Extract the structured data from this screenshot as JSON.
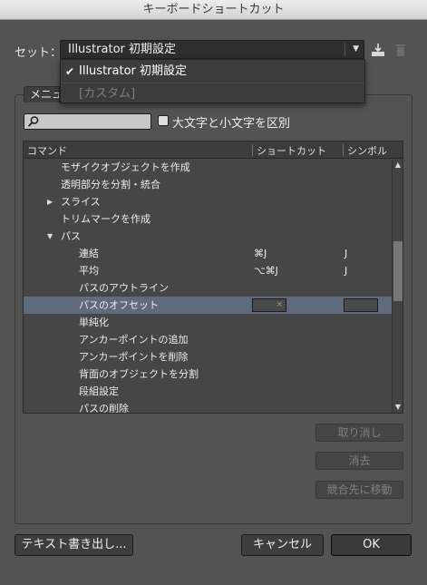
{
  "window": {
    "title": "キーボードショートカット"
  },
  "set": {
    "label": "セット：",
    "selected": "Illustrator 初期設定",
    "options": [
      {
        "label": "Illustrator 初期設定",
        "checked": true
      },
      {
        "label": "[カスタム]",
        "disabled": true
      }
    ]
  },
  "tab": {
    "label": "メニューコマンド"
  },
  "search": {
    "value": "",
    "case_label": "大文字と小文字を区別"
  },
  "table": {
    "headers": {
      "command": "コマンド",
      "shortcut": "ショートカット",
      "symbol": "シンボル"
    },
    "rows": [
      {
        "name": "モザイクオブジェクトを作成",
        "shortcut": "",
        "symbol": ""
      },
      {
        "name": "透明部分を分割・統合",
        "shortcut": "",
        "symbol": ""
      },
      {
        "name": "スライス",
        "shortcut": "",
        "symbol": "",
        "expander": "▶"
      },
      {
        "name": "トリムマークを作成",
        "shortcut": "",
        "symbol": ""
      },
      {
        "name": "パス",
        "shortcut": "",
        "symbol": "",
        "expander": "▼"
      },
      {
        "name": "連結",
        "shortcut": "⌘J",
        "symbol": "J"
      },
      {
        "name": "平均",
        "shortcut": "⌥⌘J",
        "symbol": "J"
      },
      {
        "name": "パスのアウトライン",
        "shortcut": "",
        "symbol": ""
      },
      {
        "name": "パスのオフセット",
        "shortcut": "",
        "symbol": "",
        "clear_glyph": "×"
      },
      {
        "name": "単純化",
        "shortcut": "",
        "symbol": ""
      },
      {
        "name": "アンカーポイントの追加",
        "shortcut": "",
        "symbol": ""
      },
      {
        "name": "アンカーポイントを削除",
        "shortcut": "",
        "symbol": ""
      },
      {
        "name": "背面のオブジェクトを分割",
        "shortcut": "",
        "symbol": ""
      },
      {
        "name": "段組設定",
        "shortcut": "",
        "symbol": ""
      },
      {
        "name": "パスの削除",
        "shortcut": "",
        "symbol": ""
      }
    ],
    "scroll_up_glyph": "▲",
    "scroll_down_glyph": "▼"
  },
  "side_buttons": {
    "undo": "取り消し",
    "clear": "消去",
    "goto_conflict": "競合先に移動"
  },
  "footer": {
    "export_text": "テキスト書き出し...",
    "cancel": "キャンセル",
    "ok": "OK"
  },
  "icons": {
    "save": "save-set-icon",
    "delete": "trash-icon",
    "search": "magnifier-icon"
  },
  "colors": {
    "background": "#535353",
    "selected_row": "#5f6a7c",
    "field": "#2e2e2e"
  }
}
